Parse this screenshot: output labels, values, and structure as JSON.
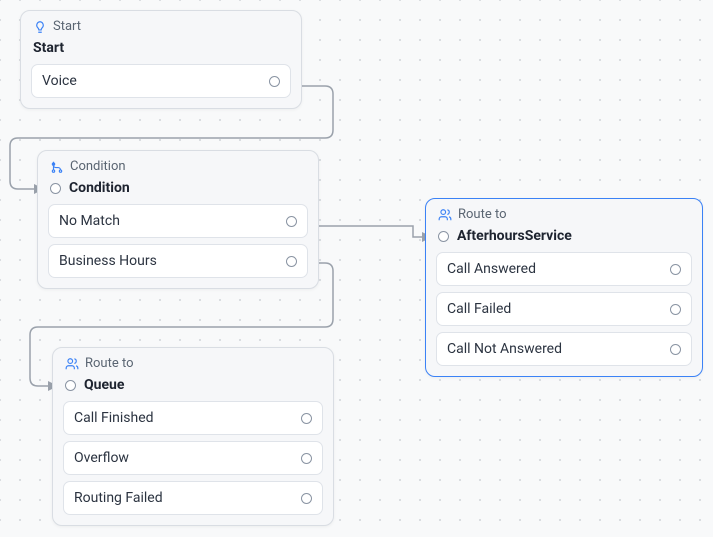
{
  "nodes": {
    "start": {
      "type_label": "Start",
      "title": "Start",
      "options": [
        "Voice"
      ]
    },
    "condition": {
      "type_label": "Condition",
      "title": "Condition",
      "options": [
        "No Match",
        "Business Hours"
      ]
    },
    "route_queue": {
      "type_label": "Route to",
      "title": "Queue",
      "options": [
        "Call Finished",
        "Overflow",
        "Routing Failed"
      ]
    },
    "route_afterhours": {
      "type_label": "Route to",
      "title": "AfterhoursService",
      "options": [
        "Call Answered",
        "Call Failed",
        "Call Not Answered"
      ]
    }
  }
}
